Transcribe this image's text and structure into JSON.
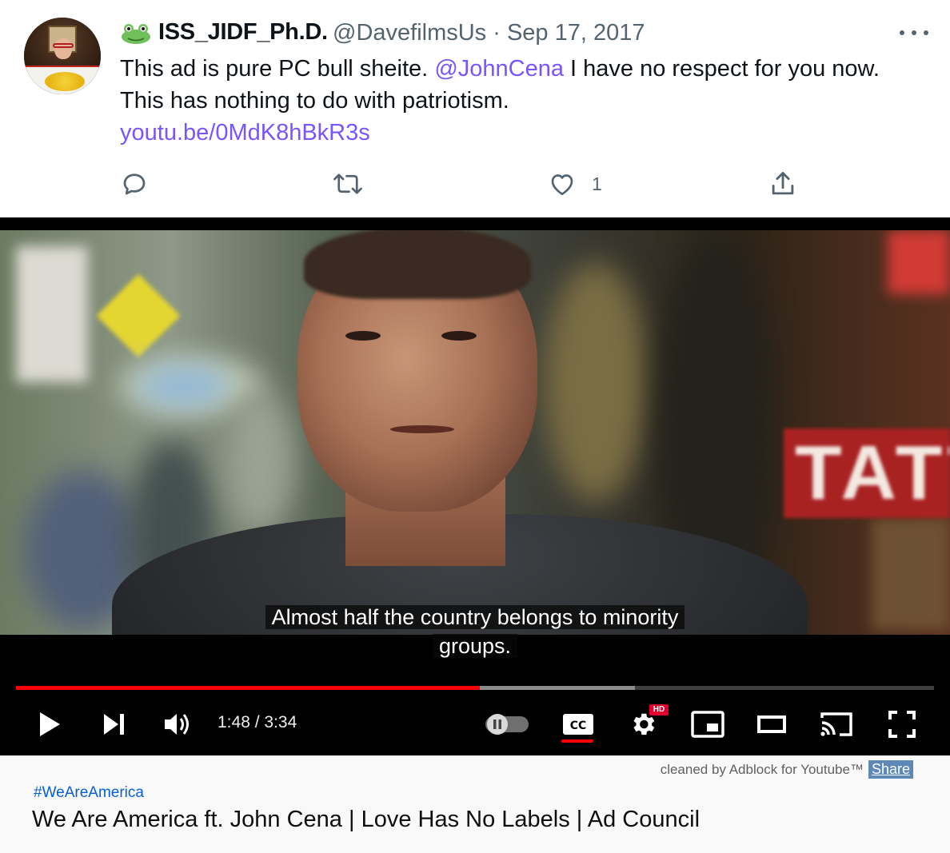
{
  "tweet": {
    "display_name": "ISS_JIDF_Ph.D.",
    "handle_and_date": "@DavefilmsUs · Sep 17, 2017",
    "text_part1": "This ad is pure PC bull sheite. ",
    "mention": "@JohnCena",
    "text_part2": " I have no respect for you now. This has nothing to do with patriotism.",
    "link": "youtu.be/0MdK8hBkR3s",
    "like_count": "1",
    "icons": [
      "frog-icon",
      "more-icon",
      "reply-icon",
      "retweet-icon",
      "like-icon",
      "share-icon"
    ]
  },
  "video": {
    "caption_line1": "Almost half the country belongs to minority",
    "caption_line2": "groups.",
    "sign_text": "TATT",
    "time": "1:48 / 3:34",
    "progress_played": 0.505,
    "progress_buffered": 0.674,
    "hd_badge": "HD",
    "accent_color": "#ff0000"
  },
  "card": {
    "adblock_text": "cleaned by Adblock for Youtube™",
    "share_label": "Share",
    "hashtag": "#WeAreAmerica",
    "title": "We Are America ft. John Cena | Love Has No Labels | Ad Council"
  }
}
